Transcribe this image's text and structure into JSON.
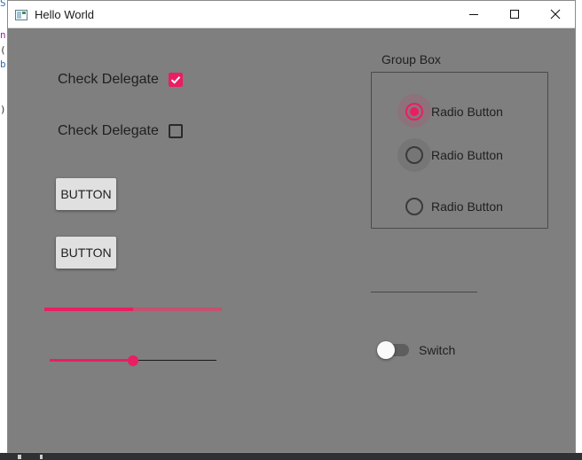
{
  "window": {
    "title": "Hello World"
  },
  "background_editor": {
    "chars": [
      "S",
      "n",
      "(",
      "b",
      ")"
    ]
  },
  "left_panel": {
    "check_delegates": [
      {
        "label": "Check Delegate",
        "checked": true
      },
      {
        "label": "Check Delegate",
        "checked": false
      }
    ],
    "buttons": [
      {
        "label": "BUTTON"
      },
      {
        "label": "BUTTON"
      }
    ],
    "progress_bar": {
      "value": 0.5
    },
    "slider": {
      "value": 0.5
    }
  },
  "group_box": {
    "title": "Group Box",
    "radios": [
      {
        "label": "Radio Button",
        "checked": true,
        "highlighted": true
      },
      {
        "label": "Radio Button",
        "checked": false,
        "hovered": true
      },
      {
        "label": "Radio Button",
        "checked": false
      }
    ]
  },
  "switch": {
    "label": "Switch",
    "on": false
  },
  "colors": {
    "accent": "#e91e63",
    "window_bg": "#7f7f7f",
    "button_bg": "#e0e0e0"
  },
  "icons": [
    "app-icon",
    "minimize-icon",
    "maximize-icon",
    "close-icon",
    "check-icon"
  ]
}
